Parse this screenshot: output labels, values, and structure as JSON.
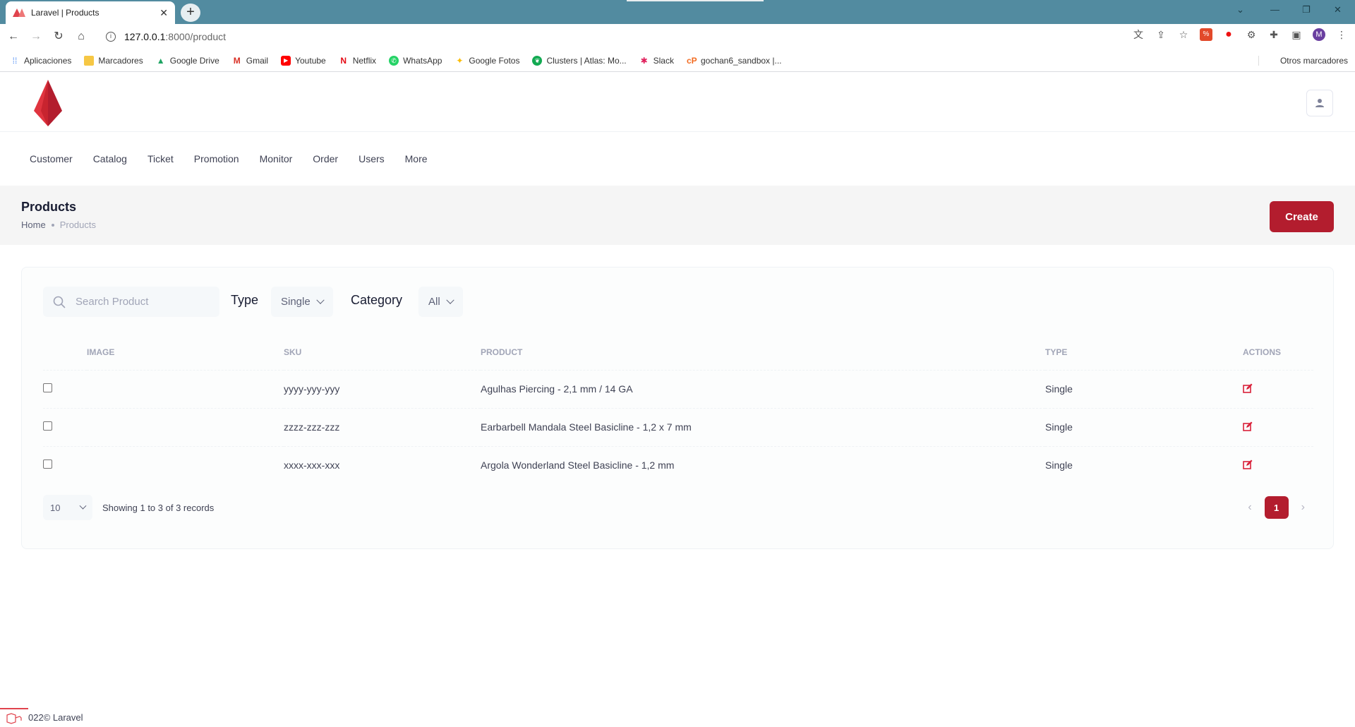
{
  "browser": {
    "tab_title": "Laravel | Products",
    "tab_close": "✕",
    "new_tab": "+",
    "url_host": "127.0.0.1",
    "url_path": ":8000/product",
    "bookmarks": [
      "Aplicaciones",
      "Marcadores",
      "Google Drive",
      "Gmail",
      "Youtube",
      "Netflix",
      "WhatsApp",
      "Google Fotos",
      "Clusters | Atlas: Mo...",
      "Slack",
      "gochan6_sandbox |..."
    ],
    "other_bookmarks": "Otros marcadores",
    "profile_initial": "M"
  },
  "nav": {
    "menu": [
      "Customer",
      "Catalog",
      "Ticket",
      "Promotion",
      "Monitor",
      "Order",
      "Users",
      "More"
    ]
  },
  "page": {
    "title": "Products",
    "breadcrumb_home": "Home",
    "breadcrumb_current": "Products",
    "create_label": "Create"
  },
  "filters": {
    "search_placeholder": "Search Product",
    "type_label": "Type",
    "type_value": "Single",
    "category_label": "Category",
    "category_value": "All"
  },
  "table": {
    "headers": [
      "Image",
      "SKU",
      "Product",
      "Type",
      "Actions"
    ],
    "rows": [
      {
        "sku": "yyyy-yyy-yyy",
        "product": "Agulhas Piercing - 2,1 mm / 14 GA",
        "type": "Single"
      },
      {
        "sku": "zzzz-zzz-zzz",
        "product": "Earbarbell Mandala Steel Basicline - 1,2 x 7 mm",
        "type": "Single"
      },
      {
        "sku": "xxxx-xxx-xxx",
        "product": "Argola Wonderland Steel Basicline - 1,2 mm",
        "type": "Single"
      }
    ]
  },
  "pagination": {
    "page_length": "10",
    "info": "Showing 1 to 3 of 3 records",
    "current_page": "1",
    "prev": "‹",
    "next": "›"
  },
  "footer": {
    "text": "022©  Laravel"
  },
  "colors": {
    "accent": "#b31d2e",
    "browser_tabbar": "#528ba0"
  }
}
